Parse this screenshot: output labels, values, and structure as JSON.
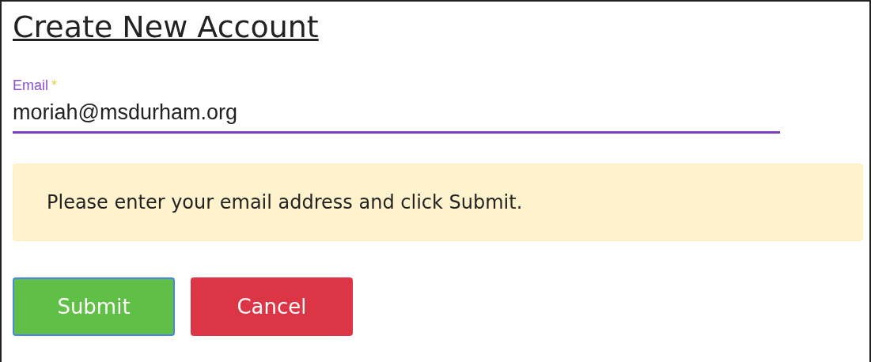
{
  "title": "Create New Account",
  "email_field": {
    "label": "Email",
    "required_mark": "*",
    "value": "moriah@msdurham.org",
    "focused": true
  },
  "alert": {
    "text": "Please enter your email address and click Submit."
  },
  "buttons": [
    {
      "label": "Submit",
      "kind": "primary",
      "focused": true
    },
    {
      "label": "Cancel",
      "kind": "danger",
      "focused": false
    }
  ]
}
